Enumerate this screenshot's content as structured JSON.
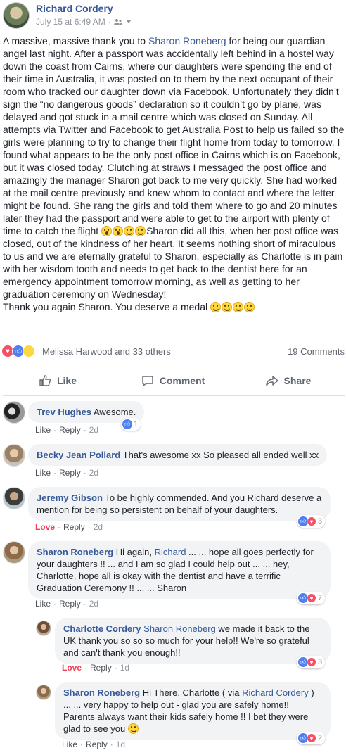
{
  "post": {
    "author": "Richard Cordery",
    "timestamp": "July 15 at 6:49 AM",
    "audience_icon": "friends-icon",
    "menu_icon": "chevron-down-icon",
    "text_before_link": "A massive, massive thank you to ",
    "tagged": "Sharon Roneberg",
    "text_after_link": " for being our guardian angel last night. After a passport was accidentally left behind in a hostel way down the coast from Cairns, where our daughters were spending the end of their time in Australia, it was posted on to them by the next occupant of their room who tracked our daughter down via Facebook. Unfortunately they didn’t sign the “no dangerous goods” declaration so it couldn’t go by plane, was delayed and got stuck in a mail centre which was closed on Sunday. All attempts via Twitter and Facebook to get Australia Post to help us failed so the girls were planning to try to change their flight home from today to tomorrow. I found what appears to be the only post office in Cairns which is on Facebook, but it was closed today. Clutching at straws I messaged the post office and amazingly the manager Sharon got back to me very quickly. She had worked at the mail centre previously and knew whom to contact and where the letter might be found. She rang the girls and told them where to go and 20 minutes later they had the passport and were able to get to the airport with plenty of time to catch the flight ",
    "text_after_emoji": "Sharon did all this, when her post office was closed, out of the kindness of her heart. It seems nothing short of miraculous to us and we are eternally grateful to Sharon, especially as Charlotte is in pain with her wisdom tooth and needs to get back to the dentist here for an emergency appointment tomorrow morning, as well as getting to her graduation ceremony on Wednesday!",
    "closing": "Thank you again Sharon. You deserve a medal "
  },
  "reactions": {
    "names": "Melissa Harwood and 33 others",
    "comments_count": "19 Comments"
  },
  "actions": {
    "like": "Like",
    "comment": "Comment",
    "share": "Share"
  },
  "comments": [
    {
      "name": "Trev Hughes",
      "text": "Awesome.",
      "like": "Like",
      "reply": "Reply",
      "time": "2d",
      "count": "1"
    },
    {
      "name": "Becky Jean Pollard",
      "text": "That's awesome xx So pleased all ended well xx",
      "like": "Like",
      "reply": "Reply",
      "time": "2d"
    },
    {
      "name": "Jeremy Gibson",
      "text": "To be highly commended. And you Richard deserve a mention for being so persistent on behalf of your daughters.",
      "like": "Love",
      "reply": "Reply",
      "time": "2d",
      "count": "3"
    },
    {
      "name": "Sharon Roneberg",
      "text_pre": "Hi again, ",
      "mention": "Richard",
      "text": " ... ... hope all goes perfectly for your daughters !! ... and I am so glad I could help out ... ... hey, Charlotte, hope all is okay with the dentist and have a terrific Graduation Ceremony !! ... ... Sharon",
      "like": "Like",
      "reply": "Reply",
      "time": "2d",
      "count": "7"
    },
    {
      "name": "Charlotte Cordery",
      "mention": "Sharon Roneberg",
      "text": " we made it back to the UK thank you so so so much for your help!! We're so grateful and can't thank you enough!!",
      "like": "Love",
      "reply": "Reply",
      "time": "1d",
      "count": "3"
    },
    {
      "name": "Sharon Roneberg",
      "text_pre": "Hi There, Charlotte ( via ",
      "mention": "Richard Cordery",
      "text": " ) ... ... very happy to help out - glad you are safely home!! Parents always want their kids safely home !! I bet they were glad to see you ",
      "like": "Like",
      "reply": "Reply",
      "time": "1d",
      "count": "2"
    }
  ],
  "colors": {
    "link": "#365899",
    "love": "#f33e58",
    "like_blue": "#4f7ff1",
    "bubble": "#f2f3f5"
  }
}
